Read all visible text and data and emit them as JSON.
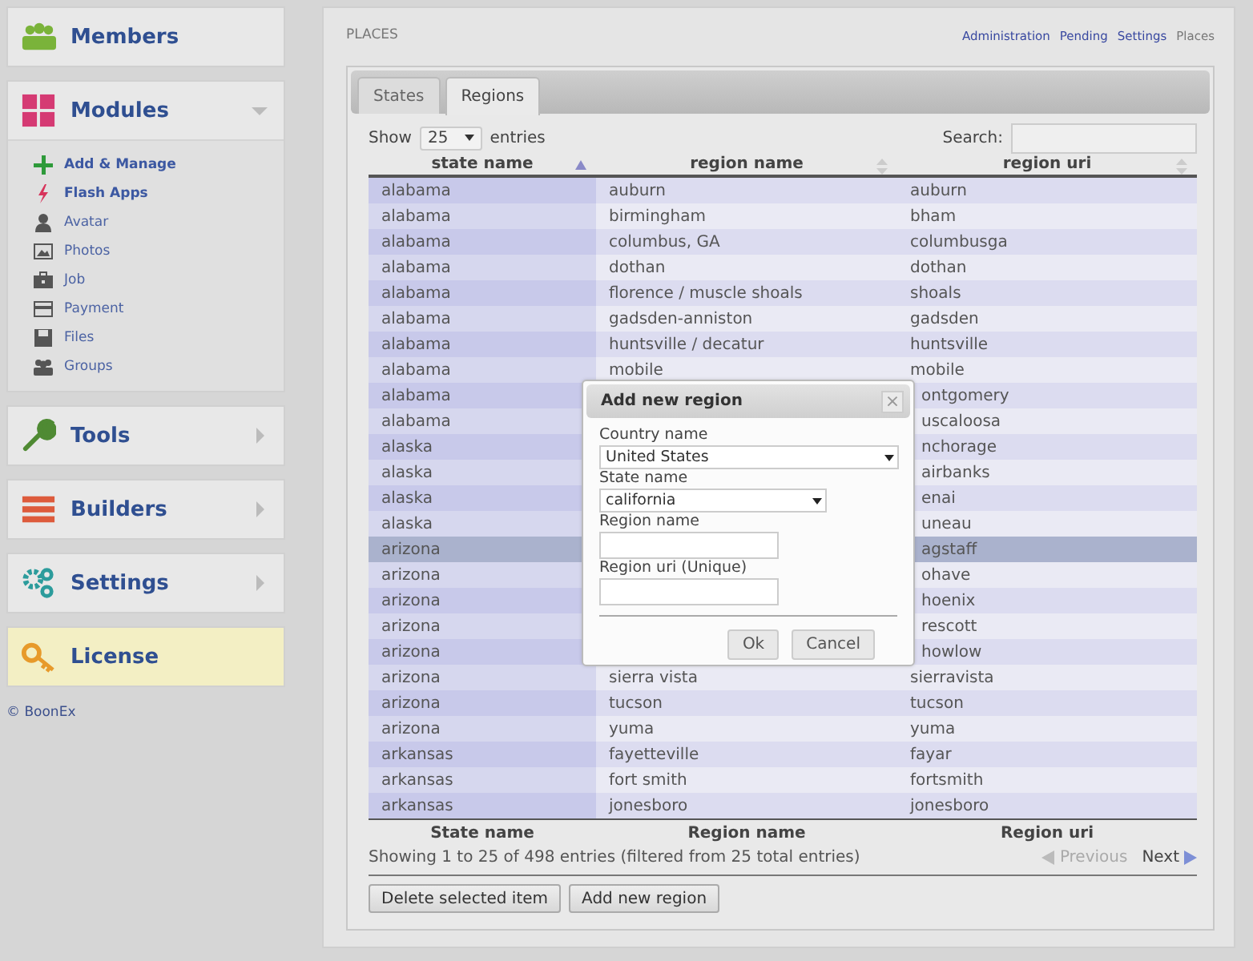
{
  "sidebar": {
    "sections": [
      {
        "label": "Members"
      },
      {
        "label": "Modules",
        "expanded": true,
        "items": [
          {
            "label": "Add & Manage",
            "highlighted": true
          },
          {
            "label": "Flash Apps",
            "highlighted": true
          },
          {
            "label": "Avatar",
            "highlighted": false
          },
          {
            "label": "Photos",
            "highlighted": false
          },
          {
            "label": "Job",
            "highlighted": false
          },
          {
            "label": "Payment",
            "highlighted": false
          },
          {
            "label": "Files",
            "highlighted": false
          },
          {
            "label": "Groups",
            "highlighted": false
          }
        ]
      },
      {
        "label": "Tools",
        "expanded": false
      },
      {
        "label": "Builders",
        "expanded": false
      },
      {
        "label": "Settings",
        "expanded": false
      },
      {
        "label": "License",
        "highlighted": true
      }
    ],
    "footer": "© BoonEx"
  },
  "page": {
    "title": "PLACES",
    "breadcrumbs": [
      {
        "label": "Administration",
        "current": false
      },
      {
        "label": "Pending",
        "current": false
      },
      {
        "label": "Settings",
        "current": false
      },
      {
        "label": "Places",
        "current": true
      }
    ]
  },
  "tabs": [
    {
      "label": "States",
      "selected": false
    },
    {
      "label": "Regions",
      "selected": true
    }
  ],
  "table": {
    "show_label": "Show",
    "page_size": "25",
    "entries_label": "entries",
    "search_label": "Search:",
    "columns": [
      {
        "label": "state name",
        "sorted": true
      },
      {
        "label": "region name",
        "sorted": false
      },
      {
        "label": "region uri",
        "sorted": false
      }
    ],
    "rows": [
      {
        "state": "alabama",
        "region": "auburn",
        "uri": "auburn",
        "selected": false
      },
      {
        "state": "alabama",
        "region": "birmingham",
        "uri": "bham",
        "selected": false
      },
      {
        "state": "alabama",
        "region": "columbus, GA",
        "uri": "columbusga",
        "selected": false
      },
      {
        "state": "alabama",
        "region": "dothan",
        "uri": "dothan",
        "selected": false
      },
      {
        "state": "alabama",
        "region": "florence / muscle shoals",
        "uri": "shoals",
        "selected": false
      },
      {
        "state": "alabama",
        "region": "gadsden-anniston",
        "uri": "gadsden",
        "selected": false
      },
      {
        "state": "alabama",
        "region": "huntsville / decatur",
        "uri": "huntsville",
        "selected": false
      },
      {
        "state": "alabama",
        "region": "mobile",
        "uri": "mobile",
        "selected": false
      },
      {
        "state": "alabama",
        "uri": "ontgomery",
        "selected": false
      },
      {
        "state": "alabama",
        "uri": "uscaloosa",
        "selected": false
      },
      {
        "state": "alaska",
        "uri": "nchorage",
        "selected": false
      },
      {
        "state": "alaska",
        "uri": "airbanks",
        "selected": false
      },
      {
        "state": "alaska",
        "uri": "enai",
        "selected": false
      },
      {
        "state": "alaska",
        "uri": "uneau",
        "selected": false
      },
      {
        "state": "arizona",
        "uri": "agstaff",
        "selected": true
      },
      {
        "state": "arizona",
        "uri": "ohave",
        "selected": false
      },
      {
        "state": "arizona",
        "uri": "hoenix",
        "selected": false
      },
      {
        "state": "arizona",
        "uri": "rescott",
        "selected": false
      },
      {
        "state": "arizona",
        "uri": "howlow",
        "selected": false
      },
      {
        "state": "arizona",
        "region": "sierra vista",
        "uri": "sierravista",
        "selected": false
      },
      {
        "state": "arizona",
        "region": "tucson",
        "uri": "tucson",
        "selected": false
      },
      {
        "state": "arizona",
        "region": "yuma",
        "uri": "yuma",
        "selected": false
      },
      {
        "state": "arkansas",
        "region": "fayetteville",
        "uri": "fayar",
        "selected": false
      },
      {
        "state": "arkansas",
        "region": "fort smith",
        "uri": "fortsmith",
        "selected": false
      },
      {
        "state": "arkansas",
        "region": "jonesboro",
        "uri": "jonesboro",
        "selected": false
      }
    ],
    "footer_columns": [
      "State name",
      "Region name",
      "Region uri"
    ],
    "info": "Showing 1 to 25 of 498 entries (filtered from 25 total entries)",
    "previous": {
      "label": "Previous",
      "disabled": true
    },
    "next": {
      "label": "Next",
      "disabled": false
    }
  },
  "buttons": [
    "Delete selected item",
    "Add new region"
  ],
  "dialog": {
    "title": "Add new region",
    "close": "×",
    "fields": [
      {
        "label": "Country name",
        "kind": "select",
        "value": "United States"
      },
      {
        "label": "State name",
        "kind": "select",
        "value": "california"
      },
      {
        "label": "Region name",
        "kind": "text"
      },
      {
        "label": "Region uri (Unique)",
        "kind": "text"
      }
    ],
    "buttons": [
      "Ok",
      "Cancel"
    ]
  }
}
